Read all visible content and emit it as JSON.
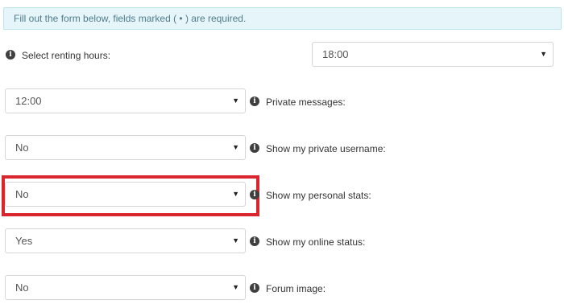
{
  "notice": {
    "text": "Fill out the form below, fields marked ( • ) are required."
  },
  "fields": {
    "renting_hours": {
      "label": "Select renting hours:",
      "value": "18:00"
    },
    "private_messages": {
      "label": "Private messages:",
      "value": "12:00"
    },
    "private_username": {
      "label": "Show my private username:",
      "value": "No"
    },
    "personal_stats": {
      "label": "Show my personal stats:",
      "value": "No"
    },
    "online_status": {
      "label": "Show my online status:",
      "value": "Yes"
    },
    "forum_image": {
      "label": "Forum image:",
      "value": "No"
    }
  },
  "icons": {
    "info": "info-icon",
    "caret": "chevron-down-icon"
  },
  "colors": {
    "notice_bg": "#e6f5fa",
    "notice_text": "#4f7c8c",
    "highlight": "#d9262e"
  }
}
